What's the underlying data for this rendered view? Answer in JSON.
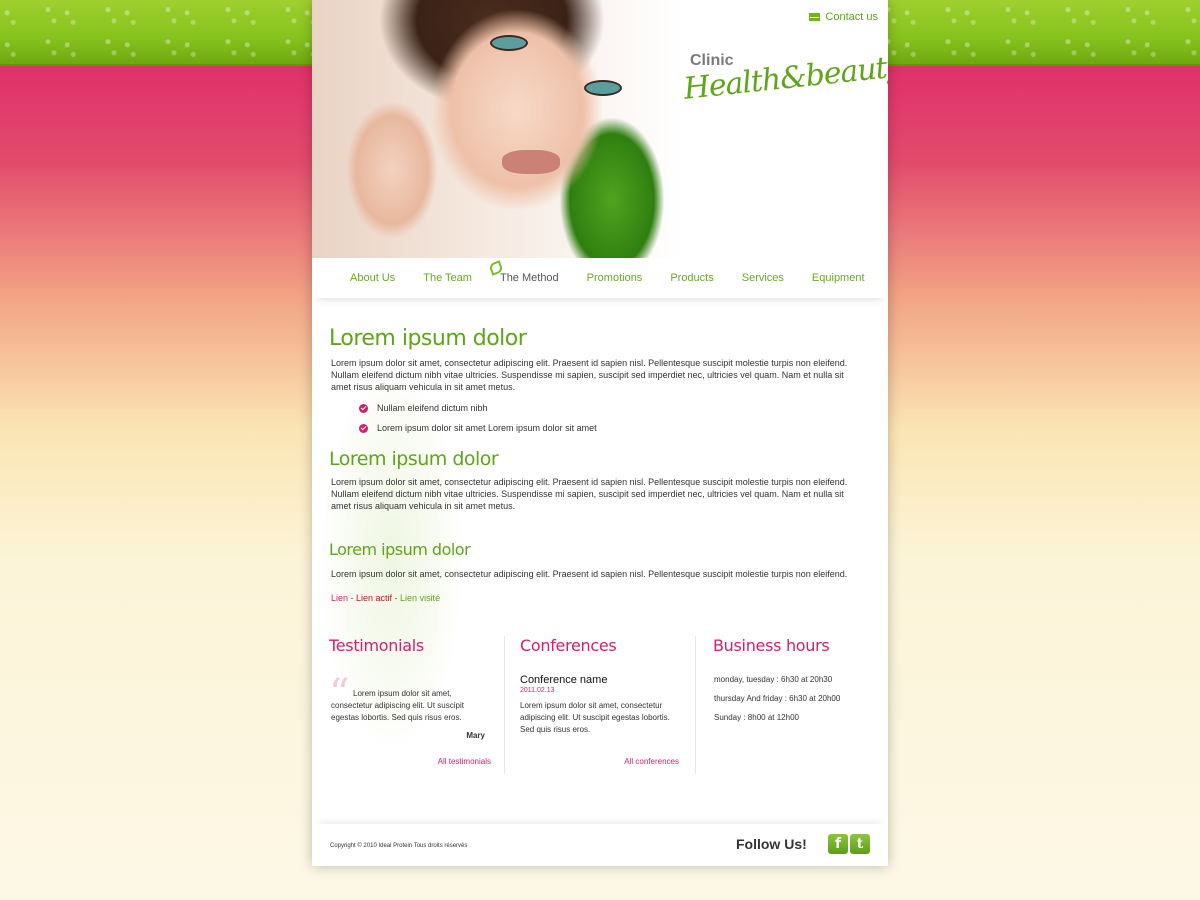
{
  "header": {
    "contact_label": "Contact us",
    "logo_clinic": "Clinic",
    "logo_brand": "Health&beauty"
  },
  "nav": {
    "items": [
      {
        "label": "About Us"
      },
      {
        "label": "The Team"
      },
      {
        "label": "The Method"
      },
      {
        "label": "Promotions"
      },
      {
        "label": "Products"
      },
      {
        "label": "Services"
      },
      {
        "label": "Equipment"
      }
    ]
  },
  "main": {
    "section1": {
      "title": "Lorem ipsum dolor",
      "text": "Lorem ipsum dolor sit amet, consectetur adipiscing elit. Praesent id sapien nisl. Pellentesque suscipit molestie turpis non eleifend. Nullam eleifend dictum nibh vitae ultricies. Suspendisse mi sapien, suscipit sed imperdiet nec, ultricies vel quam. Nam et nulla sit amet risus aliquam vehicula in sit amet metus.",
      "bullets": [
        "Nullam eleifend dictum nibh",
        "Lorem ipsum dolor sit amet Lorem ipsum dolor sit amet"
      ]
    },
    "section2": {
      "title": "Lorem ipsum dolor",
      "text": "Lorem ipsum dolor sit amet, consectetur adipiscing elit. Praesent id sapien nisl. Pellentesque suscipit molestie turpis non eleifend. Nullam eleifend dictum nibh vitae ultricies. Suspendisse mi sapien, suscipit sed imperdiet nec, ultricies vel quam. Nam et nulla sit amet risus aliquam vehicula in sit amet metus."
    },
    "section3": {
      "title": "Lorem ipsum dolor",
      "text": "Lorem ipsum dolor sit amet, consectetur adipiscing elit. Praesent id sapien nisl. Pellentesque suscipit molestie turpis non eleifend."
    },
    "links": {
      "link": "Lien",
      "active": "Lien actif",
      "visited": "Lien visité",
      "separator": " - "
    }
  },
  "testimonials": {
    "title": "Testimonials",
    "quote": "Lorem ipsum dolor sit amet, consectetur adipiscing elit. Ut suscipit egestas lobortis. Sed quis risus eros.",
    "author": "Mary",
    "more": "All testimonials"
  },
  "conferences": {
    "title": "Conferences",
    "name": "Conference name",
    "date": "2011.02.13",
    "text": "Lorem ipsum dolor sit amet, consectetur adipiscing elit. Ut suscipit egestas lobortis. Sed quis risus eros.",
    "more": "All conferences"
  },
  "hours": {
    "title": "Business hours",
    "lines": [
      "monday, tuesday : 6h30 at 20h30",
      "thursday And friday : 6h30 at 20h00",
      "Sunday : 8h00 at 12h00"
    ]
  },
  "footer": {
    "copyright": "Copyright © 2010 Ideal Protein Tous droits réservés",
    "follow": "Follow Us!",
    "facebook_glyph": "f",
    "twitter_glyph": "t"
  },
  "colors": {
    "green": "#5fa51a",
    "pink": "#d41f6c"
  }
}
